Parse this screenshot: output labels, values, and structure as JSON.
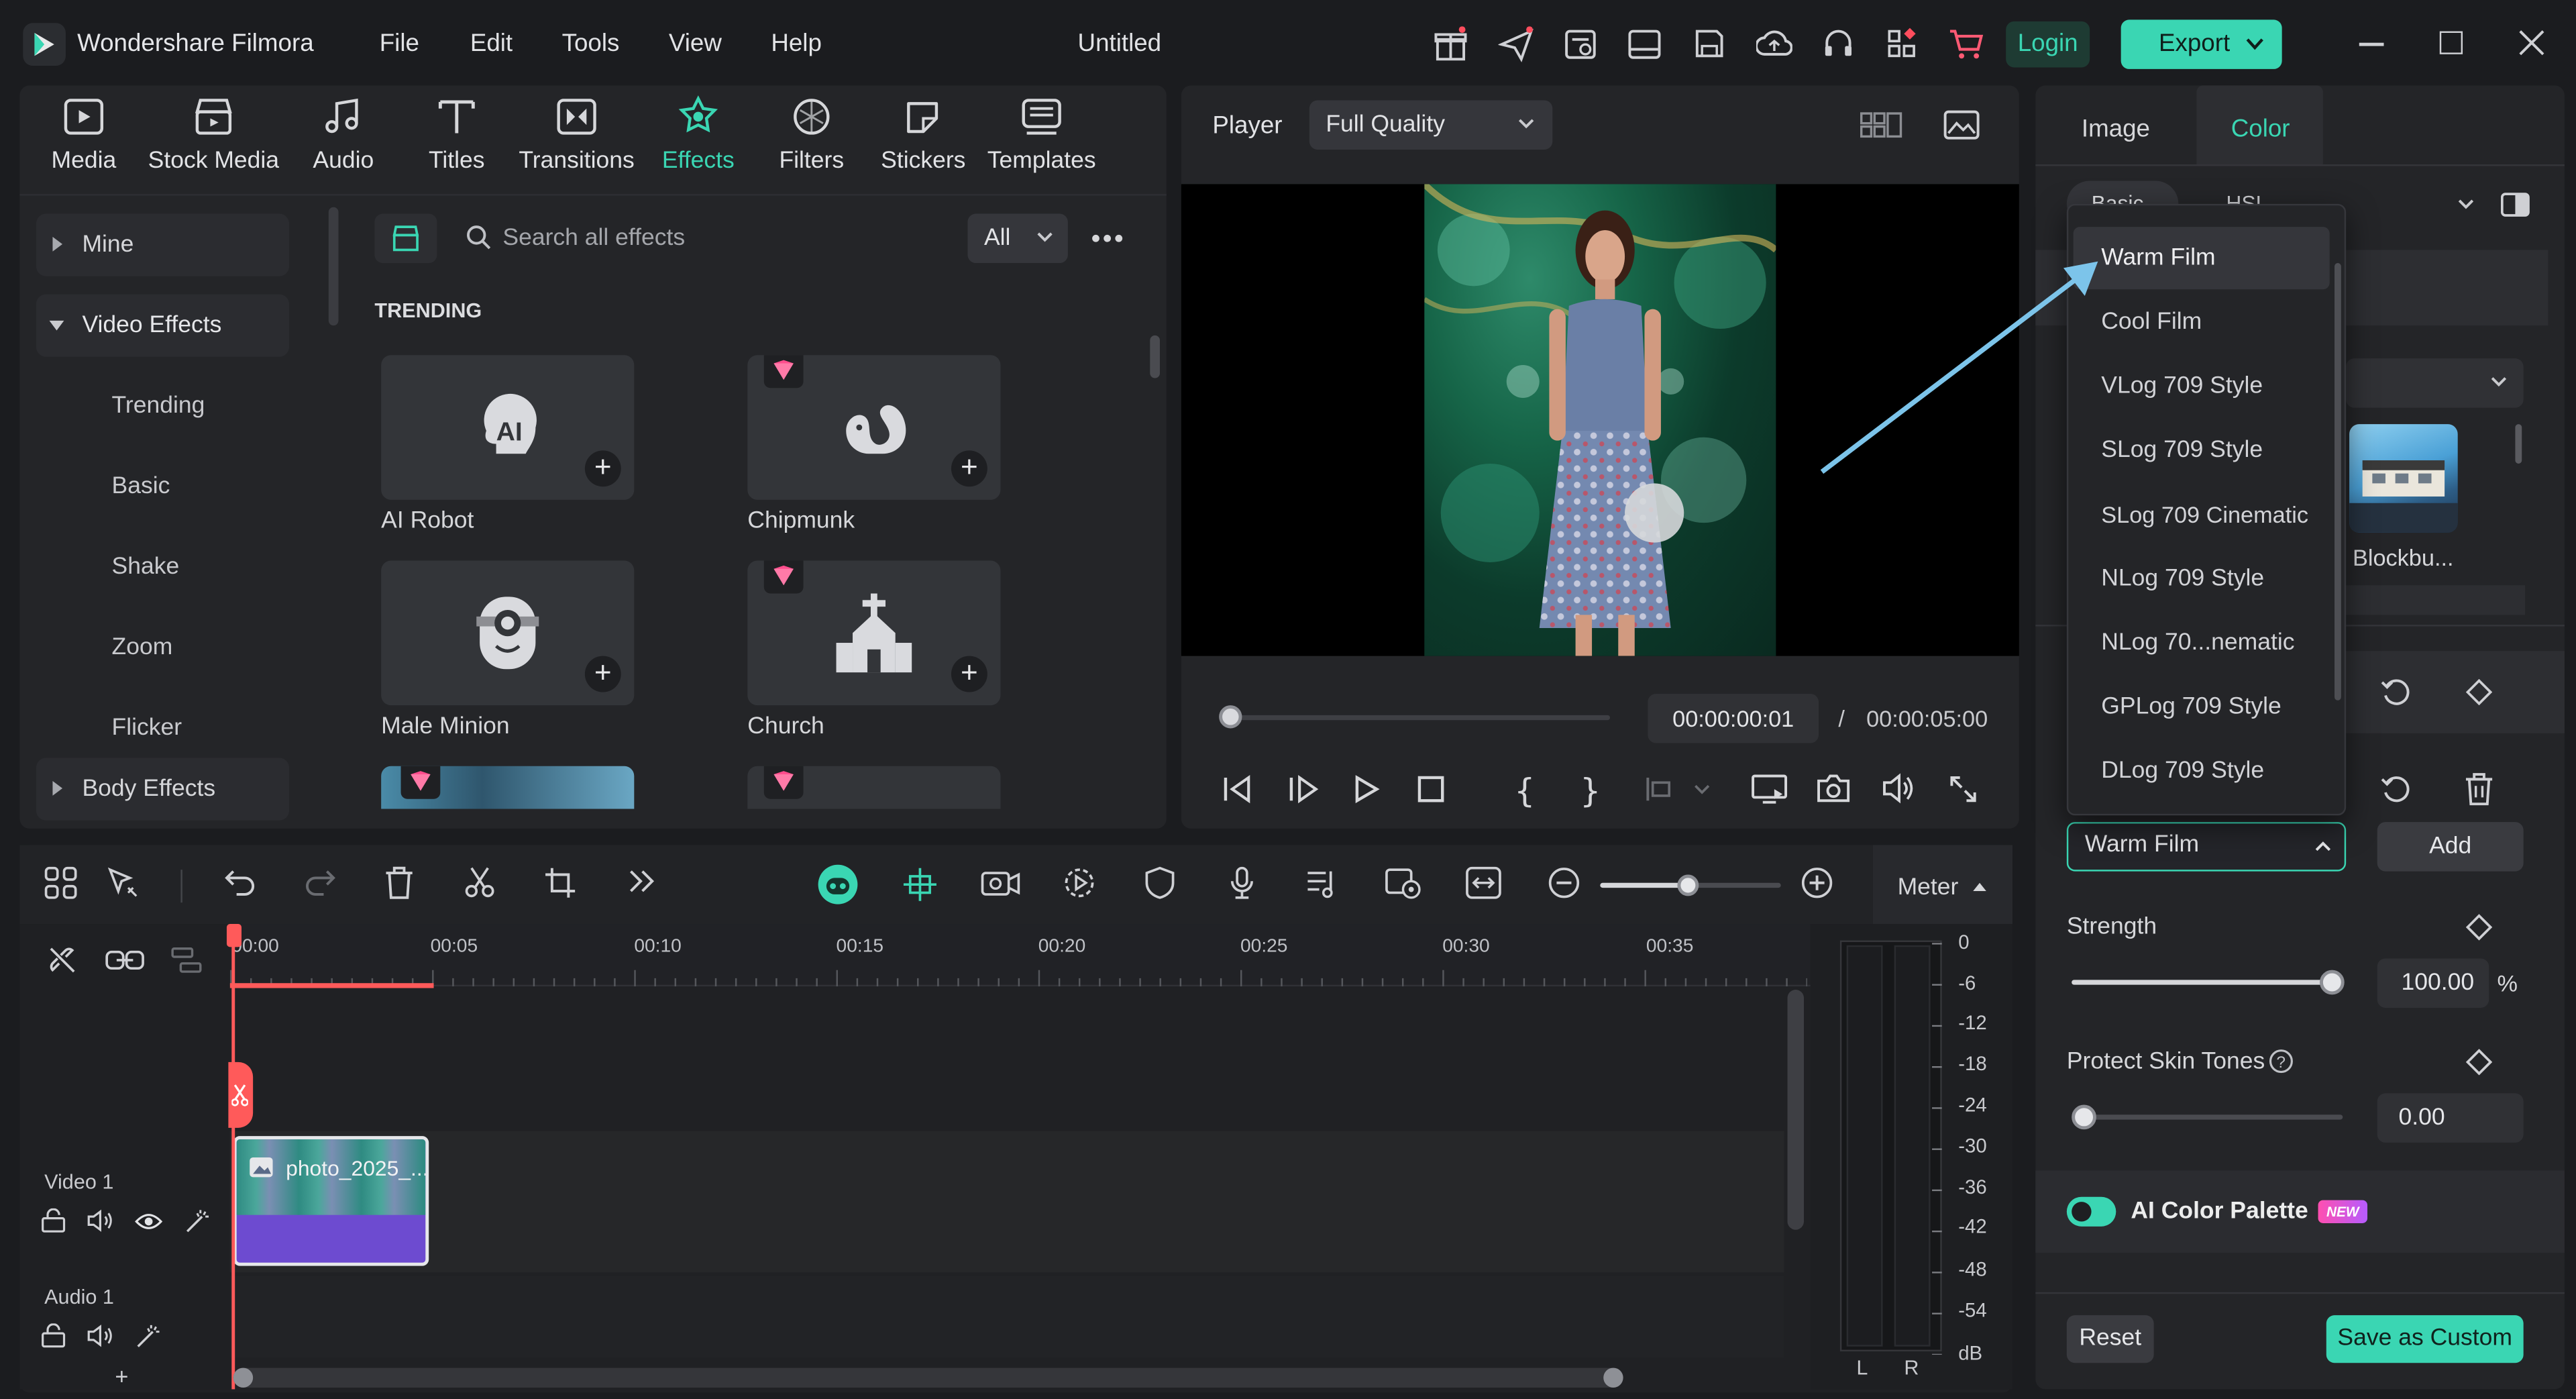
{
  "app": {
    "name": "Wondershare Filmora",
    "doc_title": "Untitled",
    "login": "Login",
    "export": "Export"
  },
  "menu": [
    "File",
    "Edit",
    "Tools",
    "View",
    "Help"
  ],
  "tools": [
    {
      "label": "Media"
    },
    {
      "label": "Stock Media"
    },
    {
      "label": "Audio"
    },
    {
      "label": "Titles"
    },
    {
      "label": "Transitions"
    },
    {
      "label": "Effects"
    },
    {
      "label": "Filters"
    },
    {
      "label": "Stickers"
    },
    {
      "label": "Templates"
    }
  ],
  "sidebar": {
    "mine": "Mine",
    "video_effects": "Video Effects",
    "subs": [
      "Trending",
      "Basic",
      "Shake",
      "Zoom",
      "Flicker"
    ],
    "body_effects": "Body Effects"
  },
  "browser": {
    "search_placeholder": "Search all effects",
    "filter": "All",
    "section": "TRENDING",
    "cards": [
      "AI Robot",
      "Chipmunk",
      "Male Minion",
      "Church"
    ]
  },
  "player": {
    "label": "Player",
    "quality": "Full Quality",
    "current_time": "00:00:00:01",
    "separator": "/",
    "total_time": "00:00:05:00",
    "progress": 0.0
  },
  "right_panel": {
    "tabs": [
      "Image",
      "Color"
    ],
    "subtabs": [
      "Basic",
      "HSL"
    ],
    "dropdown_options": [
      "Warm Film",
      "Cool Film",
      "VLog 709 Style",
      "SLog 709 Style",
      "SLog 709 Cinematic",
      "NLog 709 Style",
      "NLog 70...nematic",
      "GPLog 709 Style",
      "DLog 709 Style"
    ],
    "selected_preset": "Warm Film",
    "add_label": "Add",
    "thumb_label": "Blockbu...",
    "strength_label": "Strength",
    "strength_value": "100.00",
    "strength_unit": "%",
    "strength_level": 1.0,
    "skin_label": "Protect Skin Tones",
    "skin_value": "0.00",
    "skin_level": 0.0,
    "palette_label": "AI Color Palette",
    "new_badge": "NEW",
    "reset": "Reset",
    "save_custom": "Save as Custom"
  },
  "timeline": {
    "meter": "Meter",
    "ruler": [
      "00:00",
      "00:05",
      "00:10",
      "00:15",
      "00:20",
      "00:25",
      "00:30",
      "00:35"
    ],
    "video_track": "Video 1",
    "audio_track": "Audio 1",
    "clip_name": "photo_2025_...",
    "db_scale": [
      "0",
      "-6",
      "-12",
      "-18",
      "-24",
      "-30",
      "-36",
      "-42",
      "-48",
      "-54",
      "dB"
    ],
    "lr": [
      "L",
      "R"
    ],
    "add_track": "+"
  },
  "colors": {
    "accent": "#3ad6b3",
    "playhead": "#ff5a5a",
    "annotation_arrow": "#7cc4ea",
    "clip": "#6d4bd0"
  }
}
